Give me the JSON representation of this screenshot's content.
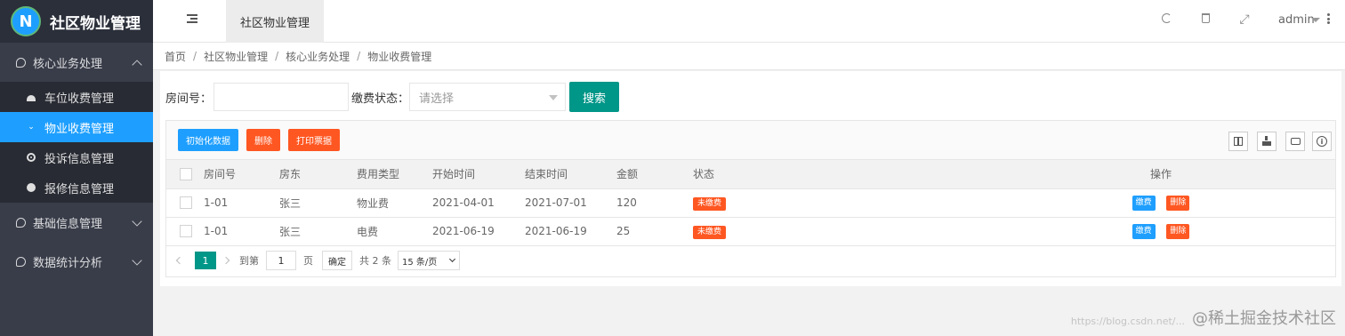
{
  "app": {
    "logo_letter": "N",
    "title": "社区物业管理"
  },
  "sidebar": {
    "groups": [
      {
        "label": "核心业务处理",
        "expanded": true,
        "items": [
          {
            "label": "车位收费管理",
            "icon": "gauge-icon"
          },
          {
            "label": "物业收费管理",
            "icon": "chevron-down-icon",
            "active": true
          },
          {
            "label": "投诉信息管理",
            "icon": "target-icon"
          },
          {
            "label": "报修信息管理",
            "icon": "compass-icon"
          }
        ]
      },
      {
        "label": "基础信息管理",
        "expanded": false
      },
      {
        "label": "数据统计分析",
        "expanded": false
      }
    ]
  },
  "header": {
    "tab_label": "社区物业管理",
    "user": "admin"
  },
  "breadcrumb": [
    "首页",
    "社区物业管理",
    "核心业务处理",
    "物业收费管理"
  ],
  "search": {
    "room_label": "房间号：",
    "room_value": "",
    "status_label": "缴费状态：",
    "status_placeholder": "请选择",
    "search_button": "搜索"
  },
  "toolbar": {
    "init_button": "初始化数据",
    "delete_button": "删除",
    "print_button": "打印票据",
    "colors": {
      "blue": "#1e9fff",
      "orange": "#ff5722",
      "green": "#009688"
    }
  },
  "table": {
    "headers": [
      "房间号",
      "房东",
      "费用类型",
      "开始时间",
      "结束时间",
      "金额",
      "状态",
      "操作"
    ],
    "rows": [
      {
        "room": "1-01",
        "owner": "张三",
        "type": "物业费",
        "start": "2021-04-01",
        "end": "2021-07-01",
        "amount": "120",
        "status": "未缴费",
        "pay": "缴费",
        "del": "删除"
      },
      {
        "room": "1-01",
        "owner": "张三",
        "type": "电费",
        "start": "2021-06-19",
        "end": "2021-06-19",
        "amount": "25",
        "status": "未缴费",
        "pay": "缴费",
        "del": "删除"
      }
    ]
  },
  "pager": {
    "current": "1",
    "goto_label": "到第",
    "goto_value": "1",
    "page_unit": "页",
    "confirm": "确定",
    "total": "共 2 条",
    "page_size": "15 条/页"
  },
  "watermark": {
    "text": "@稀土掘金技术社区",
    "url": "https://blog.csdn.net/..."
  }
}
